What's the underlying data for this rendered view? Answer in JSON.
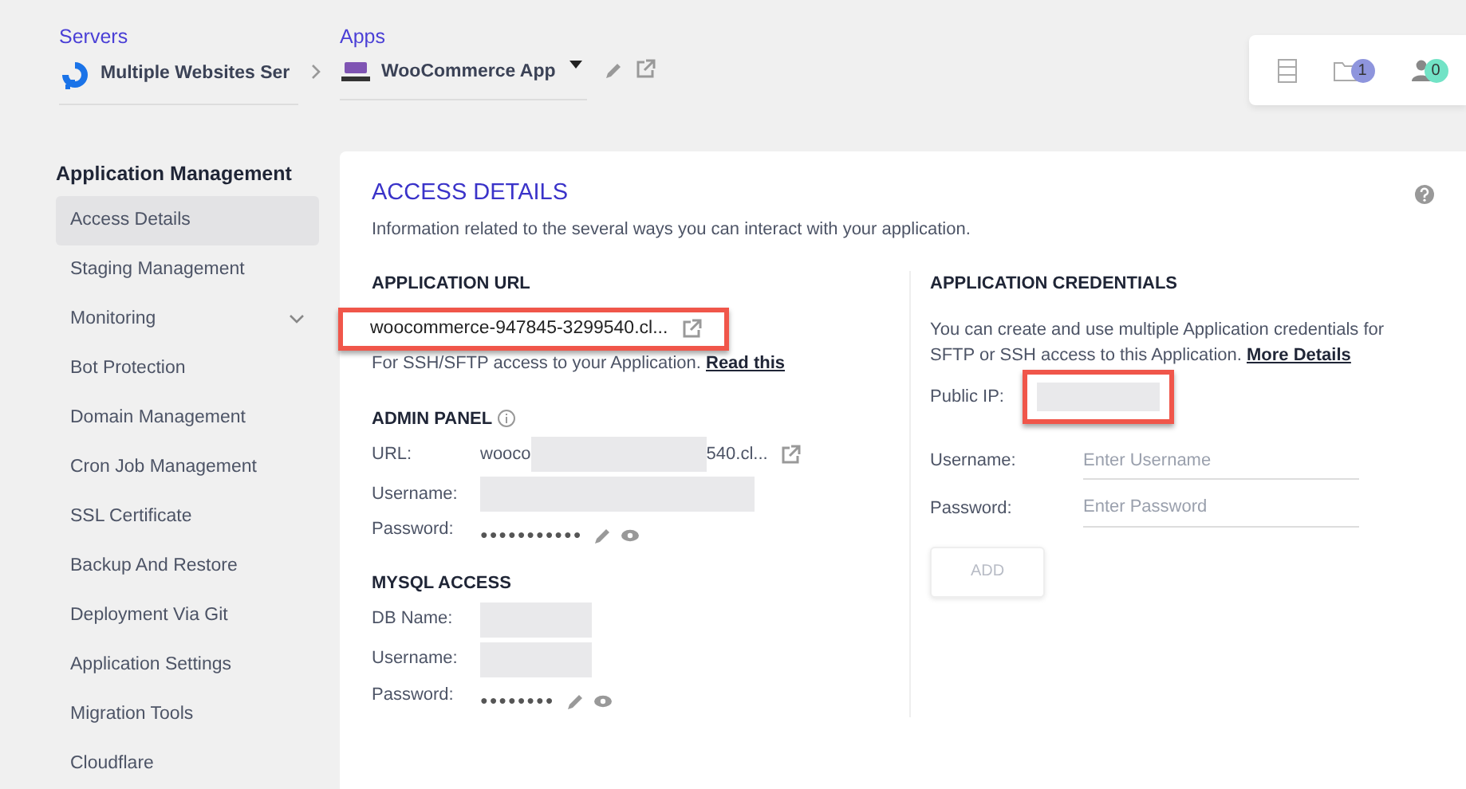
{
  "breadcrumb": [
    {
      "label": "Servers",
      "value": "Multiple Websites Ser",
      "kind": "server"
    },
    {
      "label": "Apps",
      "value": "WooCommerce App",
      "kind": "app"
    }
  ],
  "top_icons": [
    {
      "kind": "list"
    },
    {
      "kind": "folder",
      "count": "1",
      "color": "#8e95dd"
    },
    {
      "kind": "user",
      "count": "0",
      "color": "#72e3c6"
    }
  ],
  "sidebar": {
    "heading": "Application Management",
    "items": [
      {
        "label": "Access Details",
        "selected": true,
        "kind": "link"
      },
      {
        "label": "Staging Management",
        "selected": false,
        "kind": "link"
      },
      {
        "label": "Monitoring",
        "selected": false,
        "kind": "group"
      },
      {
        "label": "Bot Protection",
        "selected": false,
        "kind": "link"
      },
      {
        "label": "Domain Management",
        "selected": false,
        "kind": "link"
      },
      {
        "label": "Cron Job Management",
        "selected": false,
        "kind": "link"
      },
      {
        "label": "SSL Certificate",
        "selected": false,
        "kind": "link"
      },
      {
        "label": "Backup And Restore",
        "selected": false,
        "kind": "link"
      },
      {
        "label": "Deployment Via Git",
        "selected": false,
        "kind": "link"
      },
      {
        "label": "Application Settings",
        "selected": false,
        "kind": "link"
      },
      {
        "label": "Migration Tools",
        "selected": false,
        "kind": "link"
      },
      {
        "label": "Cloudflare",
        "selected": false,
        "kind": "link"
      }
    ]
  },
  "main": {
    "title": "ACCESS DETAILS",
    "subtitle": "Information related to the several ways you can interact with your application.",
    "application_url": {
      "heading": "APPLICATION URL",
      "url": "woocommerce-947845-3299540.cl...",
      "highlighted": true,
      "note": "For SSH/SFTP access to your Application.",
      "note_link": "Read this"
    },
    "admin_panel": {
      "heading": "ADMIN PANEL",
      "fields": [
        {
          "label": "URL:",
          "kind": "url",
          "start": "wooco",
          "end": "540.cl..."
        },
        {
          "label": "Username:",
          "kind": "redacted"
        },
        {
          "label": "Password:",
          "kind": "password",
          "value": "●●●●●●●●●●●"
        }
      ]
    },
    "mysql_access": {
      "heading": "MYSQL ACCESS",
      "fields": [
        {
          "label": "DB Name:",
          "kind": "redacted"
        },
        {
          "label": "Username:",
          "kind": "redacted"
        },
        {
          "label": "Password:",
          "kind": "password",
          "value": "●●●●●●●●"
        }
      ]
    },
    "credentials": {
      "heading": "APPLICATION CREDENTIALS",
      "description": "You can create and use multiple Application credentials for SFTP or SSH access to this Application.",
      "description_link": "More Details",
      "public_ip": {
        "label": "Public IP:",
        "highlighted": true
      },
      "inputs": [
        {
          "label": "Username:",
          "placeholder": "Enter Username"
        },
        {
          "label": "Password:",
          "placeholder": "Enter Password"
        }
      ],
      "button": {
        "label": "ADD",
        "disabled": true
      }
    }
  }
}
